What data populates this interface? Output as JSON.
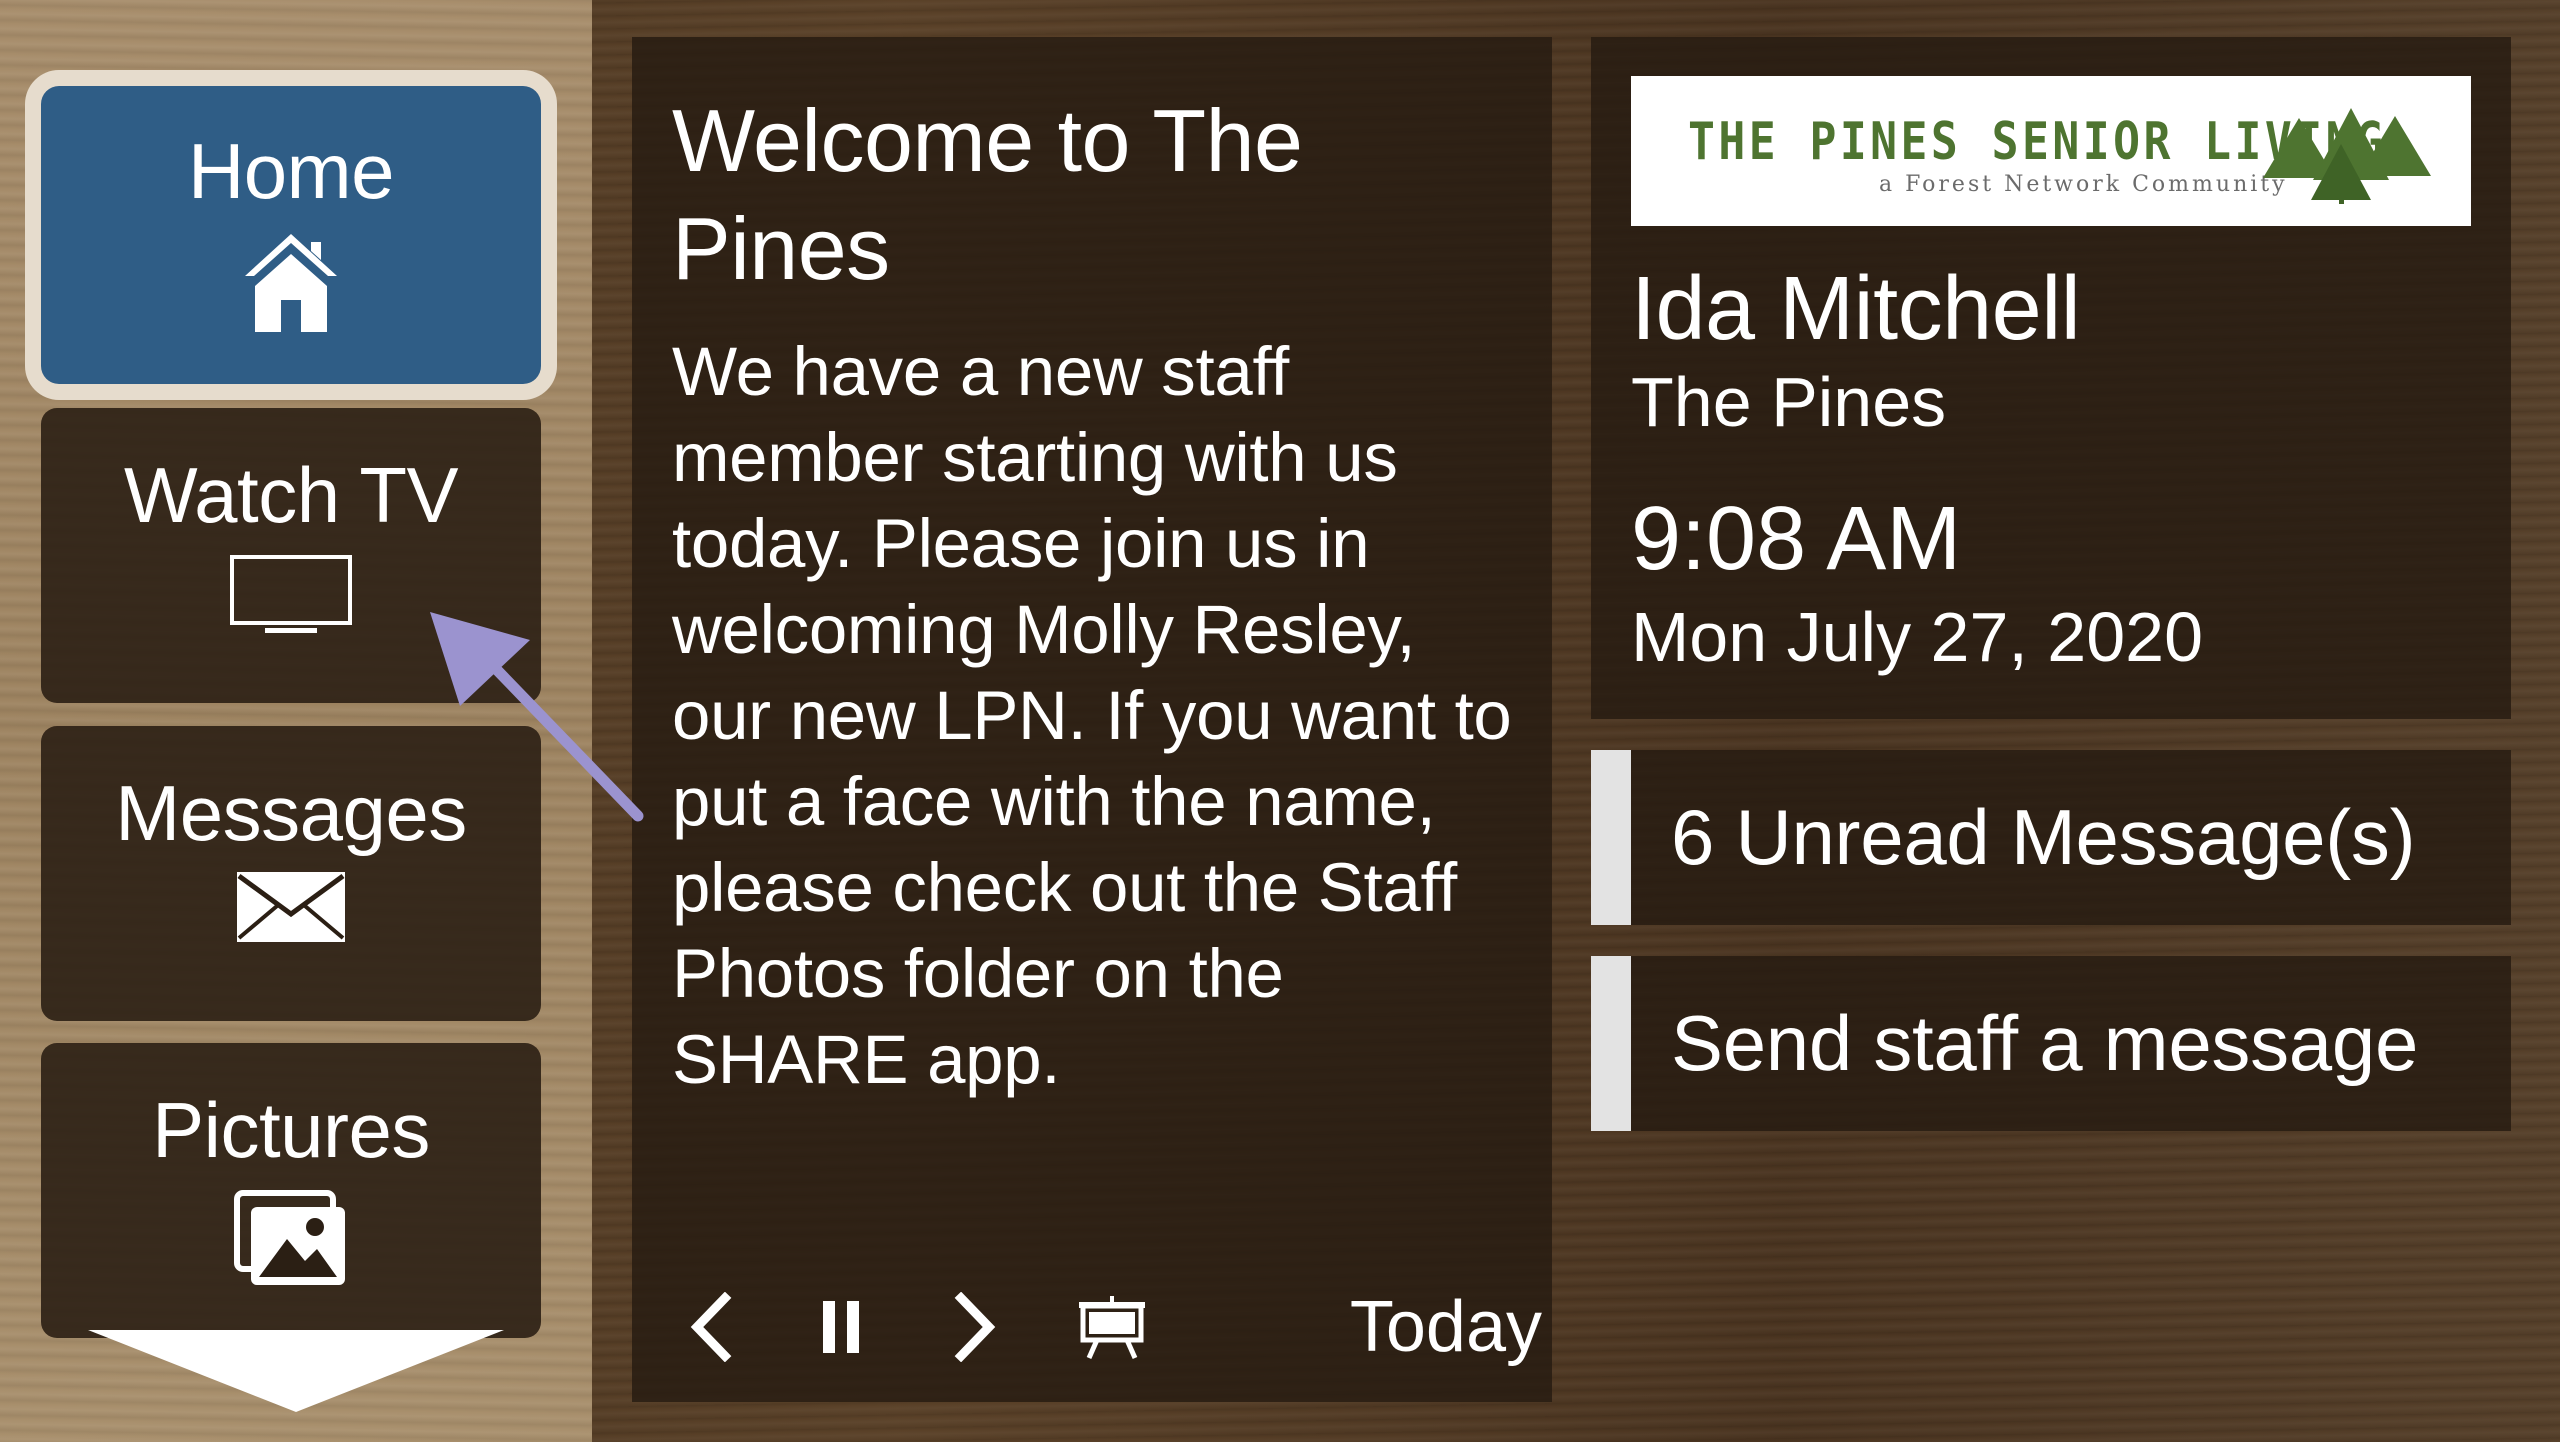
{
  "sidebar": {
    "items": [
      {
        "label": "Home",
        "icon": "home-icon",
        "selected": true
      },
      {
        "label": "Watch TV",
        "icon": "tv-icon"
      },
      {
        "label": "Messages",
        "icon": "envelope-icon"
      },
      {
        "label": "Pictures",
        "icon": "photos-icon"
      }
    ],
    "scroll_icon": "triangle-down-icon"
  },
  "announcement": {
    "title": "Welcome to The Pines",
    "body": "We have a new staff member starting with us today. Please join us in welcoming Molly Resley, our new LPN. If you want to put a face with the name, please check out the Staff Photos folder on the SHARE app.",
    "controls": {
      "prev_icon": "chevron-left-icon",
      "pause_icon": "pause-icon",
      "next_icon": "chevron-right-icon",
      "present_icon": "presentation-icon",
      "today_label": "Today"
    }
  },
  "info": {
    "logo_title": "THE PINES SENIOR LIVING",
    "logo_subtitle": "a Forest Network Community",
    "resident_name": "Ida Mitchell",
    "community": "The Pines",
    "time": "9:08 AM",
    "date": "Mon July 27, 2020"
  },
  "actions": {
    "unread_label": "6 Unread Message(s)",
    "send_label": "Send staff a message"
  },
  "colors": {
    "selected_nav": "#2f5d86",
    "logo_green": "#4e7430",
    "pointer_arrow": "#9b93cf"
  }
}
